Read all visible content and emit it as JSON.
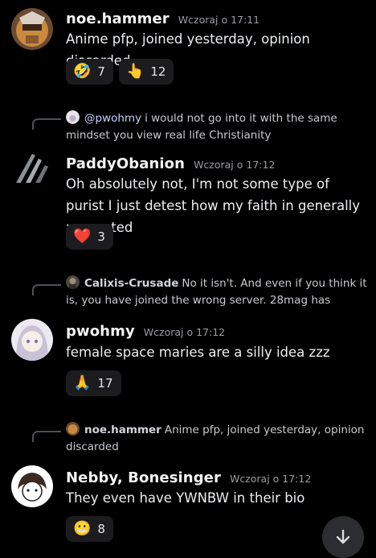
{
  "messages": [
    {
      "author": "noe.hammer",
      "timestamp": "Wczoraj o 17:11",
      "content": "Anime pfp, joined yesterday, opinion discarded",
      "reactions": [
        {
          "emoji": "🤣",
          "count": "7"
        },
        {
          "emoji": "👆",
          "count": "12"
        }
      ]
    },
    {
      "reply": {
        "mention": "@pwohmy",
        "text": "i would not go into it with the same mindset you view real life Christianity"
      },
      "author": "PaddyObanion",
      "timestamp": "Wczoraj o 17:12",
      "content": "Oh absolutely not, I'm not some type of purist I just detest how my faith in generally presented",
      "reactions": [
        {
          "emoji": "❤️",
          "count": "3"
        }
      ]
    },
    {
      "reply": {
        "name": "Calixis-Crusade",
        "text": "No it isn't. And even if you think it is, you have joined the wrong server. 28mag has"
      },
      "author": "pwohmy",
      "timestamp": "Wczoraj o 17:12",
      "content": "female space maries are a silly idea zzz",
      "reactions": [
        {
          "emoji": "🙏",
          "count": "17"
        }
      ]
    },
    {
      "reply": {
        "name": "noe.hammer",
        "text": "Anime pfp, joined yesterday, opinion discarded"
      },
      "author": "Nebby, Bonesinger",
      "timestamp": "Wczoraj o 17:12",
      "content": "They even have YWNBW in their bio",
      "reactions": [
        {
          "emoji": "😬",
          "count": "8"
        }
      ]
    }
  ],
  "icons": {
    "scroll_button": "arrow-down-icon"
  },
  "colors": {
    "background": "#000000",
    "reaction_bg": "#1c1c1f",
    "mention": "#c9cdfb",
    "timestamp": "#9a9ca3"
  }
}
